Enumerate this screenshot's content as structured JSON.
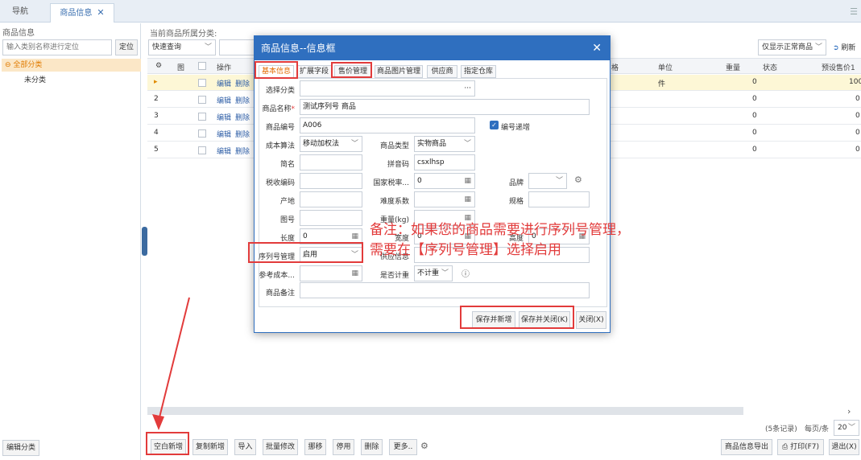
{
  "tabs": {
    "nav": "导航",
    "goods": "商品信息",
    "close": "✕"
  },
  "left": {
    "title": "商品信息",
    "search_placeholder": "输入类别名称进行定位",
    "locate": "定位",
    "all": "⊖ 全部分类",
    "uncat": "未分类",
    "edit_cat": "编辑分类"
  },
  "toolbar": {
    "current_label": "当前商品所属分类:",
    "quick_query": "快速查询",
    "filter": "仅显示正常商品",
    "refresh": "刷新"
  },
  "grid": {
    "headers": {
      "ops": "操作",
      "unit": "单位",
      "weight": "重量",
      "status": "状态",
      "price": "预设售价1",
      "extra": "格"
    },
    "rows": [
      {
        "n": "▸",
        "edit": "编辑",
        "del": "删除",
        "unit": "件",
        "weight": "0",
        "price": "100"
      },
      {
        "n": "2",
        "edit": "编辑",
        "del": "删除",
        "unit": "",
        "weight": "0",
        "price": "0"
      },
      {
        "n": "3",
        "edit": "编辑",
        "del": "删除",
        "unit": "",
        "weight": "0",
        "price": "0"
      },
      {
        "n": "4",
        "edit": "编辑",
        "del": "删除",
        "unit": "",
        "weight": "0",
        "price": "0"
      },
      {
        "n": "5",
        "edit": "编辑",
        "del": "删除",
        "unit": "",
        "weight": "0",
        "price": "0"
      }
    ]
  },
  "pager": {
    "records": "(5条记录)",
    "per_page": "每页/条",
    "size": "20"
  },
  "bottom": {
    "new": "空白新增",
    "copy_new": "复制新增",
    "import": "导入",
    "batch": "批量修改",
    "move": "挪移",
    "disable": "停用",
    "delete": "删除",
    "more": "更多..",
    "export": "商品信息导出",
    "print": "打印(F7)",
    "exit": "退出(X)"
  },
  "dialog": {
    "title": "商品信息--信息框",
    "close": "✕",
    "tabs": [
      "基本信息",
      "扩展字段",
      "售价管理",
      "商品图片管理",
      "供应商",
      "指定仓库"
    ],
    "labels": {
      "cat": "选择分类",
      "name": "商品名称",
      "code": "商品编号",
      "autoinc": "编号递增",
      "cost": "成本算法",
      "type": "商品类型",
      "short": "简名",
      "pinyin": "拼音码",
      "tax": "税收编码",
      "taxrate": "国家税率...",
      "brand": "品牌",
      "origin": "产地",
      "diff": "难度系数",
      "spec": "规格",
      "fig": "图号",
      "weight": "重量(kg)",
      "len": "长度",
      "width": "宽度",
      "height": "高度",
      "serial": "序列号管理",
      "supplier": "供应信息",
      "refcost": "参考成本...",
      "measure": "是否计重",
      "remark": "商品备注"
    },
    "values": {
      "cat": "···",
      "name": "测试序列号 商品",
      "code": "A006",
      "cost": "移动加权法",
      "type": "实物商品",
      "pinyin": "csxlhsp",
      "taxrate": "0",
      "len": "0",
      "width": "0",
      "height": "0",
      "serial": "启用",
      "measure": "不计重",
      "required": "*",
      "info": "ⓘ"
    },
    "buttons": {
      "save_new": "保存并新增",
      "save_close": "保存并关闭(K)",
      "close": "关闭(X)"
    }
  },
  "note": {
    "line1": "备注：如果您的商品需要进行序列号管理，",
    "line2": "需要在【序列号管理】选择启用"
  },
  "colors": {
    "accent": "#2f6fbf",
    "annotation": "#e23b3b"
  }
}
